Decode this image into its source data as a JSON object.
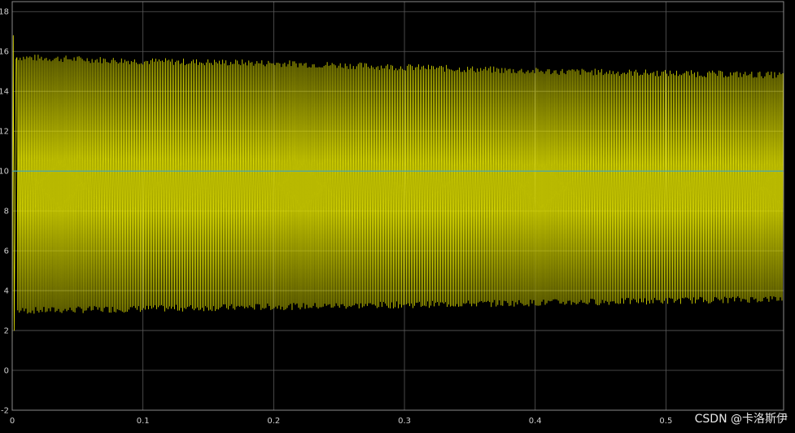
{
  "colors": {
    "background": "#000000",
    "plot_area": "#000000",
    "grid": "#5a5a5a",
    "axis_frame": "#8a8a8a",
    "signal": "#e8e800",
    "reference": "#3aa6c4",
    "tick_text": "#cfcfcf"
  },
  "watermark": "CSDN @卡洛斯伊",
  "chart_data": {
    "type": "line",
    "title": "",
    "xlabel": "",
    "ylabel": "",
    "xlim": [
      0,
      0.59
    ],
    "ylim": [
      -2,
      18.5
    ],
    "grid": true,
    "x_tick_labels": [
      "0",
      "0.1",
      "0.2",
      "0.3",
      "0.4",
      "0.5"
    ],
    "x_ticks": [
      0,
      0.1,
      0.2,
      0.3,
      0.4,
      0.5
    ],
    "y_tick_labels": [
      "-2",
      "0",
      "2",
      "4",
      "6",
      "8",
      "10",
      "12",
      "14",
      "16",
      "18"
    ],
    "y_ticks": [
      -2,
      0,
      2,
      4,
      6,
      8,
      10,
      12,
      14,
      16,
      18
    ],
    "series": [
      {
        "color": "#e8e800",
        "style": "oscillating",
        "initial_transient": {
          "t": [
            0,
            0.0008,
            0.0015,
            0.003
          ],
          "y": [
            0,
            16.8,
            2.0,
            15.6
          ]
        },
        "envelope": {
          "t": [
            0.003,
            0.1,
            0.2,
            0.3,
            0.4,
            0.5,
            0.59
          ],
          "max": [
            15.7,
            15.5,
            15.4,
            15.2,
            15.0,
            14.9,
            14.8
          ],
          "min": [
            3.0,
            3.1,
            3.2,
            3.3,
            3.4,
            3.5,
            3.6
          ]
        },
        "cycles_shown": 470
      },
      {
        "color": "#3aa6c4",
        "style": "constant",
        "t": [
          0,
          0.59
        ],
        "y": [
          10,
          10
        ]
      }
    ]
  }
}
